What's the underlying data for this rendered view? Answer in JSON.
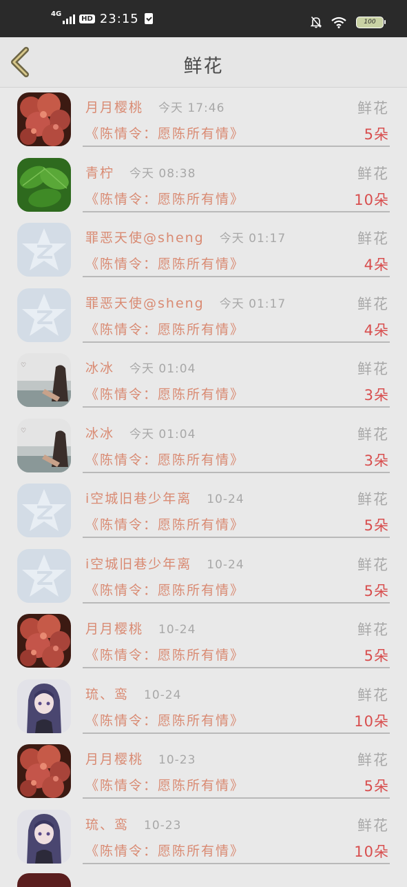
{
  "status_bar": {
    "network": "4G",
    "hd": "HD",
    "time": "23:15",
    "battery": "100"
  },
  "header": {
    "title": "鲜花"
  },
  "records": [
    {
      "sender": "月月樱桃",
      "time": "今天 17:46",
      "gift": "鲜花",
      "book": "《陈情令：愿陈所有情》",
      "count": "5朵",
      "avatar": "flower"
    },
    {
      "sender": "青柠",
      "time": "今天 08:38",
      "gift": "鲜花",
      "book": "《陈情令：愿陈所有情》",
      "count": "10朵",
      "avatar": "leaf"
    },
    {
      "sender": "罪恶天使@sheng",
      "time": "今天 01:17",
      "gift": "鲜花",
      "book": "《陈情令：愿陈所有情》",
      "count": "4朵",
      "avatar": "default"
    },
    {
      "sender": "罪恶天使@sheng",
      "time": "今天 01:17",
      "gift": "鲜花",
      "book": "《陈情令：愿陈所有情》",
      "count": "4朵",
      "avatar": "default"
    },
    {
      "sender": "冰冰",
      "time": "今天 01:04",
      "gift": "鲜花",
      "book": "《陈情令：愿陈所有情》",
      "count": "3朵",
      "avatar": "photo"
    },
    {
      "sender": "冰冰",
      "time": "今天 01:04",
      "gift": "鲜花",
      "book": "《陈情令：愿陈所有情》",
      "count": "3朵",
      "avatar": "photo"
    },
    {
      "sender": "i空城旧巷少年离",
      "time": "10-24",
      "gift": "鲜花",
      "book": "《陈情令：愿陈所有情》",
      "count": "5朵",
      "avatar": "default"
    },
    {
      "sender": "i空城旧巷少年离",
      "time": "10-24",
      "gift": "鲜花",
      "book": "《陈情令：愿陈所有情》",
      "count": "5朵",
      "avatar": "default"
    },
    {
      "sender": "月月樱桃",
      "time": "10-24",
      "gift": "鲜花",
      "book": "《陈情令：愿陈所有情》",
      "count": "5朵",
      "avatar": "flower"
    },
    {
      "sender": "琉、鸾",
      "time": "10-24",
      "gift": "鲜花",
      "book": "《陈情令：愿陈所有情》",
      "count": "10朵",
      "avatar": "anime"
    },
    {
      "sender": "月月樱桃",
      "time": "10-23",
      "gift": "鲜花",
      "book": "《陈情令：愿陈所有情》",
      "count": "5朵",
      "avatar": "flower"
    },
    {
      "sender": "琉、鸾",
      "time": "10-23",
      "gift": "鲜花",
      "book": "《陈情令：愿陈所有情》",
      "count": "10朵",
      "avatar": "anime"
    }
  ]
}
